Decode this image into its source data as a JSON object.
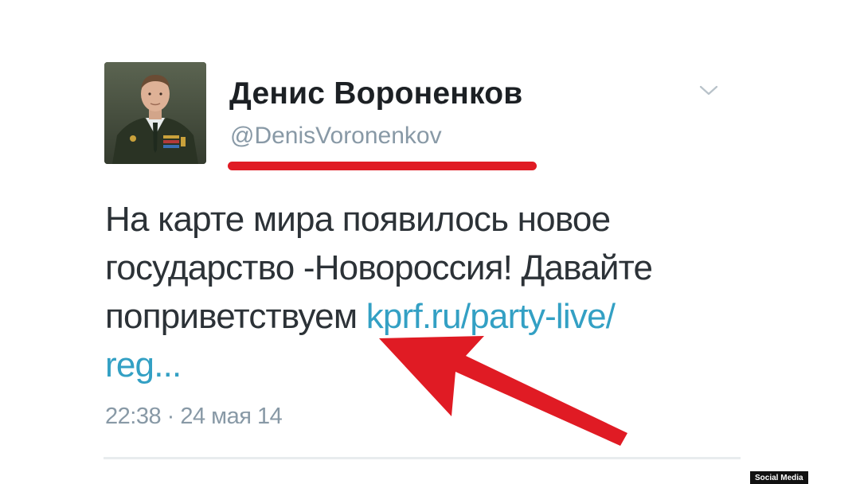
{
  "author": {
    "display_name": "Денис Вороненков",
    "handle": "@DenisVoronenkov"
  },
  "tweet": {
    "text_line_1": "На карте мира появилось новое",
    "text_line_2": "государство -Новороссия! Давайте",
    "text_line_3_prefix": "поприветствуем ",
    "link_part_1": "kprf.ru/party-live/",
    "link_part_2": "reg...",
    "timestamp": "22:38 · 24 мая 14"
  },
  "icons": {
    "menu": "chevron-down-icon",
    "annotation": "red-arrow"
  },
  "colors": {
    "annotation_red": "#e01b24",
    "link_blue": "#33a0c4",
    "muted_gray": "#8899a6"
  },
  "watermark": {
    "label": "Social Media"
  }
}
